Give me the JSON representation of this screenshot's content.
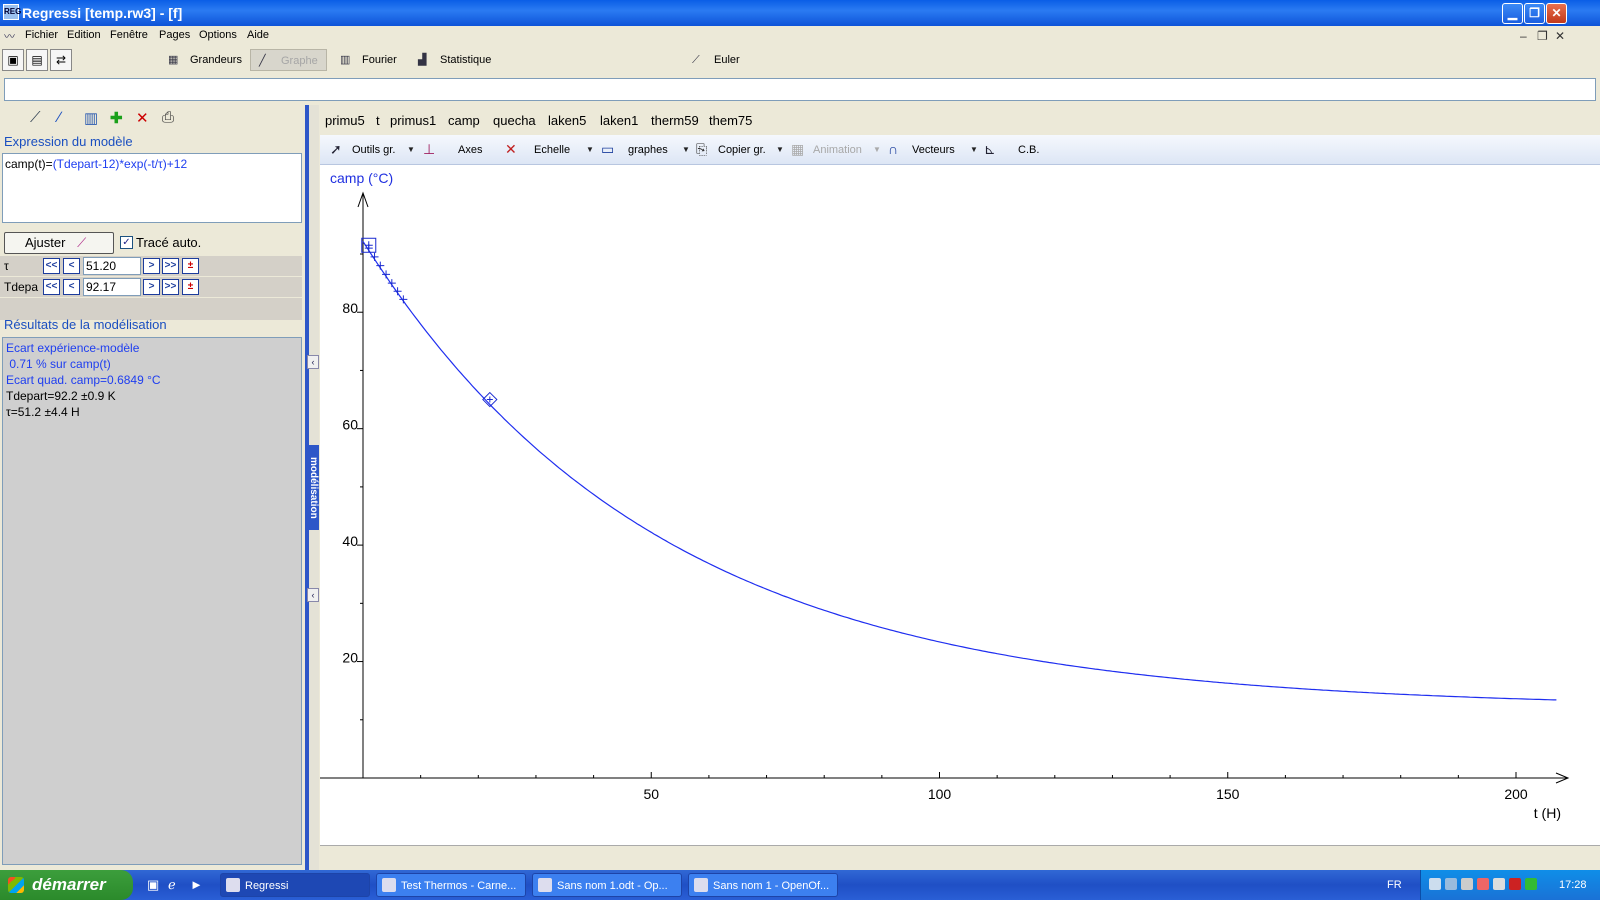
{
  "window": {
    "title": "Regressi [temp.rw3] - [f]",
    "app_icon_text": "REG"
  },
  "menu": [
    "Fichier",
    "Edition",
    "Fenêtre",
    "Pages",
    "Options",
    "Aide"
  ],
  "main_toolbar": {
    "tabs": [
      "Grandeurs",
      "Graphe",
      "Fourier",
      "Statistique",
      "Euler"
    ],
    "active_tab": "Graphe"
  },
  "command_line": {
    "value": ""
  },
  "left_panel": {
    "model_title": "Expression du modèle",
    "model_lhs": "camp(t)=",
    "model_rhs": "(Tdepart-12)*exp(-t/τ)+12",
    "fit_button": "Ajuster",
    "auto_trace_label": "Tracé auto.",
    "auto_trace_checked": true,
    "params": [
      {
        "name": "τ",
        "value": "51.20"
      },
      {
        "name": "Tdepa",
        "value": "92.17"
      }
    ],
    "buttons": {
      "first": "<<",
      "prev": "<",
      "next": ">",
      "last": ">>",
      "pm": "±"
    },
    "results_title": "Résultats de la modélisation",
    "results": [
      {
        "text": "Ecart expérience-modèle",
        "color": "blue"
      },
      {
        "text": " 0.71 % sur camp(t)",
        "color": "blue"
      },
      {
        "text": "Ecart quad. camp=0.6849 °C",
        "color": "blue"
      },
      {
        "text": "Tdepart=92.2 ±0.9 K",
        "color": "black"
      },
      {
        "text": "τ=51.2 ±4.4 H",
        "color": "black"
      }
    ],
    "side_tab": "modélisation"
  },
  "variables_bar": [
    "primu5",
    "t",
    "primus1",
    "camp",
    "quecha",
    "laken5",
    "laken1",
    "therm59",
    "them75"
  ],
  "graph_toolbar": {
    "outils": "Outils gr.",
    "axes": "Axes",
    "echelle": "Echelle",
    "graphes": "graphes",
    "copier": "Copier gr.",
    "animation": "Animation",
    "vecteurs": "Vecteurs",
    "cb": "C.B."
  },
  "chart_data": {
    "type": "scatter",
    "ylabel": "camp (°C)",
    "xlabel": "t (H)",
    "xlim": [
      0,
      207
    ],
    "ylim": [
      0,
      97
    ],
    "xticks": [
      "50",
      "100",
      "150",
      "200"
    ],
    "yticks": [
      "20",
      "40",
      "60",
      "80"
    ],
    "model": {
      "expression": "(Tdepart-12)*exp(-t/τ)+12",
      "Tdepart": 92.17,
      "tau": 51.2,
      "x_range": [
        0,
        207
      ]
    },
    "series": [
      {
        "marker": "+",
        "points": [
          [
            1,
            91.0
          ],
          [
            2,
            89.5
          ],
          [
            3,
            88.0
          ],
          [
            4,
            86.5
          ],
          [
            5,
            85.0
          ],
          [
            6,
            83.6
          ],
          [
            7,
            82.2
          ]
        ]
      },
      {
        "marker": "square-cursor",
        "points": [
          [
            1,
            91.5
          ]
        ]
      },
      {
        "marker": "diamond-cursor",
        "points": [
          [
            22,
            65.0
          ]
        ]
      }
    ],
    "grid": false,
    "colors": {
      "curve": "#1f2ef0",
      "axes": "#000000",
      "ylabel": "#2030e0"
    }
  },
  "taskbar": {
    "start_label": "démarrer",
    "tasks": [
      {
        "label": "Regressi",
        "active": true
      },
      {
        "label": "Test Thermos - Carne...",
        "active": false
      },
      {
        "label": "Sans nom 1.odt - Op...",
        "active": false
      },
      {
        "label": "Sans nom 1 - OpenOf...",
        "active": false
      }
    ],
    "lang": "FR",
    "clock": "17:28"
  }
}
